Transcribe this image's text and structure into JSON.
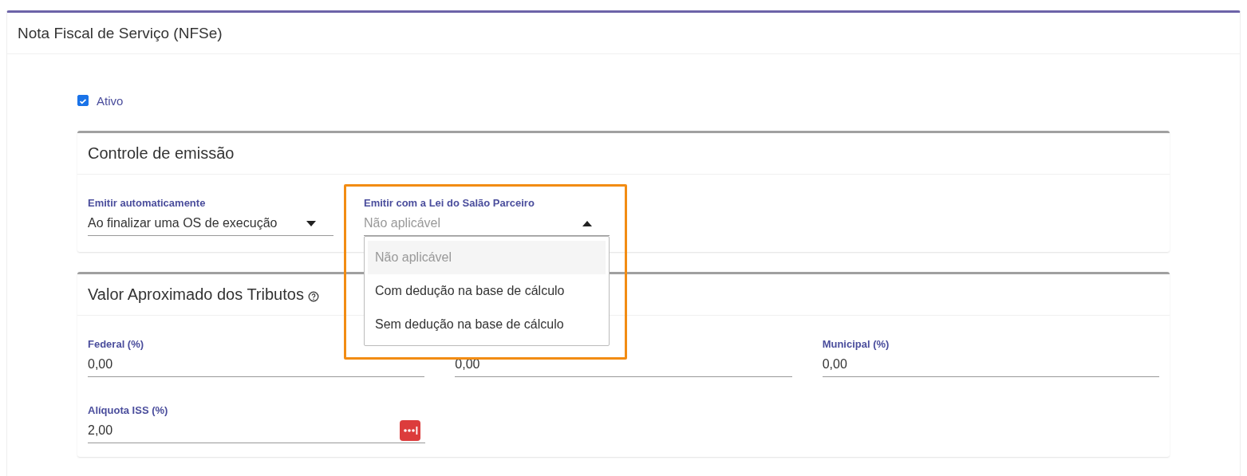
{
  "card": {
    "title": "Nota Fiscal de Serviço (NFSe)"
  },
  "active": {
    "label": "Ativo",
    "checked": true
  },
  "emission": {
    "title": "Controle de emissão",
    "fields": [
      {
        "label": "Emitir automaticamente",
        "value": "Ao finalizar uma OS de execução",
        "expanded": false
      },
      {
        "label": "Emitir com a Lei do Salão Parceiro",
        "placeholder": "Não aplicável",
        "expanded": true,
        "highlighted": true,
        "options": [
          {
            "label": "Não aplicável",
            "selected": true
          },
          {
            "label": "Com dedução na base de cálculo",
            "selected": false
          },
          {
            "label": "Sem dedução na base de cálculo",
            "selected": false
          }
        ]
      }
    ]
  },
  "taxes": {
    "title": "Valor Aproximado dos Tributos",
    "rows": [
      [
        {
          "label": "Federal (%)",
          "value": "0,00"
        },
        {
          "value": "0,00"
        },
        {
          "label": "Municipal (%)",
          "value": "0,00"
        }
      ],
      [
        {
          "label": "Alíquota ISS (%)",
          "value": "2,00",
          "badge": true
        }
      ]
    ]
  }
}
